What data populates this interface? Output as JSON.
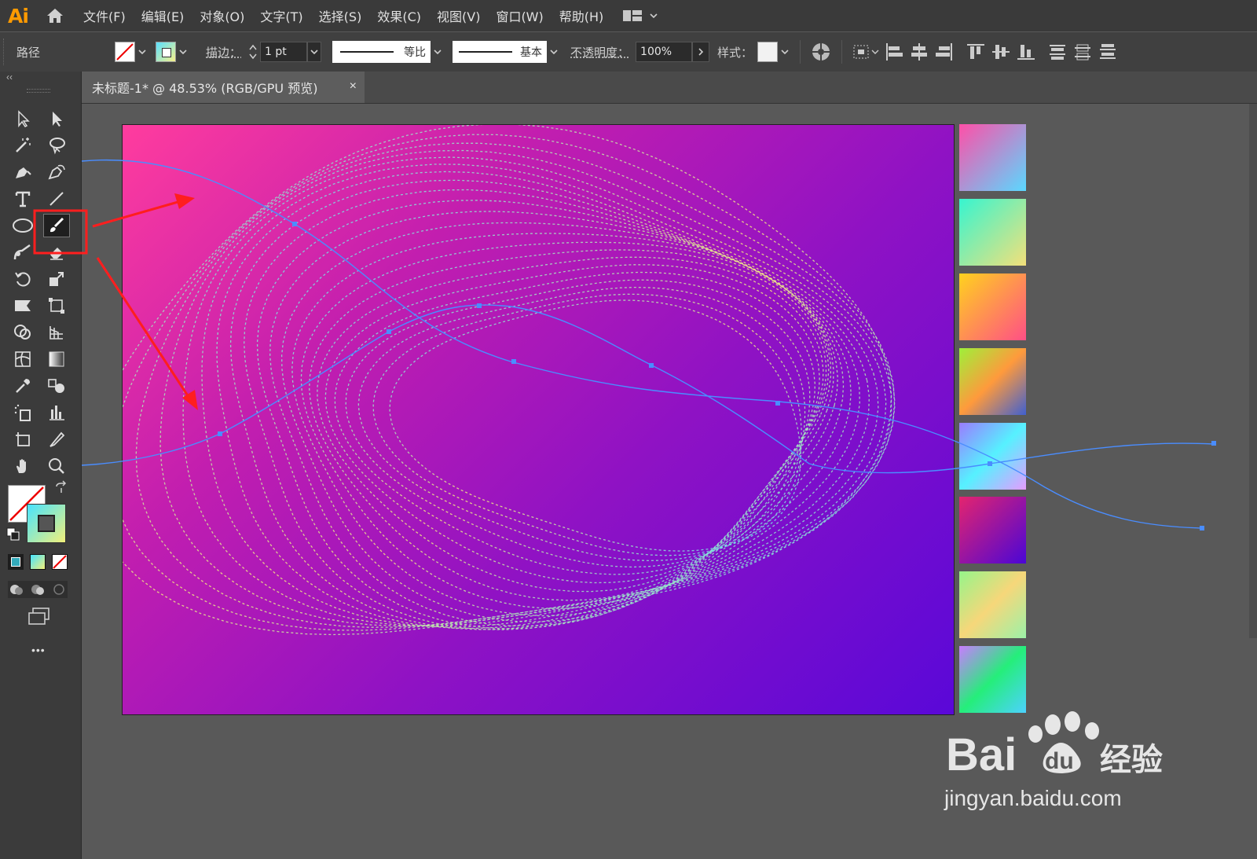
{
  "app": {
    "logo": "Ai"
  },
  "menu": [
    "文件(F)",
    "编辑(E)",
    "对象(O)",
    "文字(T)",
    "选择(S)",
    "效果(C)",
    "视图(V)",
    "窗口(W)",
    "帮助(H)"
  ],
  "control_bar": {
    "selection_label": "路径",
    "stroke_label": "描边：",
    "stroke_weight": "1 pt",
    "profile_label": "等比",
    "brush_label": "基本",
    "opacity_label": "不透明度：",
    "opacity_value": "100%",
    "style_label": "样式："
  },
  "panel_collapse": "‹‹",
  "document": {
    "tab_title": "未标题-1* @ 48.53% (RGB/GPU 预览)",
    "close": "×"
  },
  "toolbar": {
    "more": "•••"
  },
  "gradient_swatches": [
    [
      "#ff4fa8",
      "#5ad8ff"
    ],
    [
      "#36f5d0",
      "#f3e07a"
    ],
    [
      "#ffd21e",
      "#ff4f86"
    ],
    [
      "#9ef03a",
      "#ff9a3c",
      "#4060d0"
    ],
    [
      "#9a7cff",
      "#56f1ff",
      "#e59cff"
    ],
    [
      "#e4246e",
      "#4a06d6"
    ],
    [
      "#95f58a",
      "#f6d77a",
      "#9bf2a8"
    ],
    [
      "#c87cff",
      "#25ee7a",
      "#4cd2ff"
    ]
  ],
  "colors": {
    "accent_orange": "#ff9a00",
    "highlight_red": "#ff2222",
    "artboard_gradient": [
      "#ff3c9e",
      "#5a08d8"
    ]
  },
  "watermark": {
    "brand": "Bai",
    "brand2": "du",
    "cn": "经验",
    "url": "jingyan.baidu.com"
  }
}
